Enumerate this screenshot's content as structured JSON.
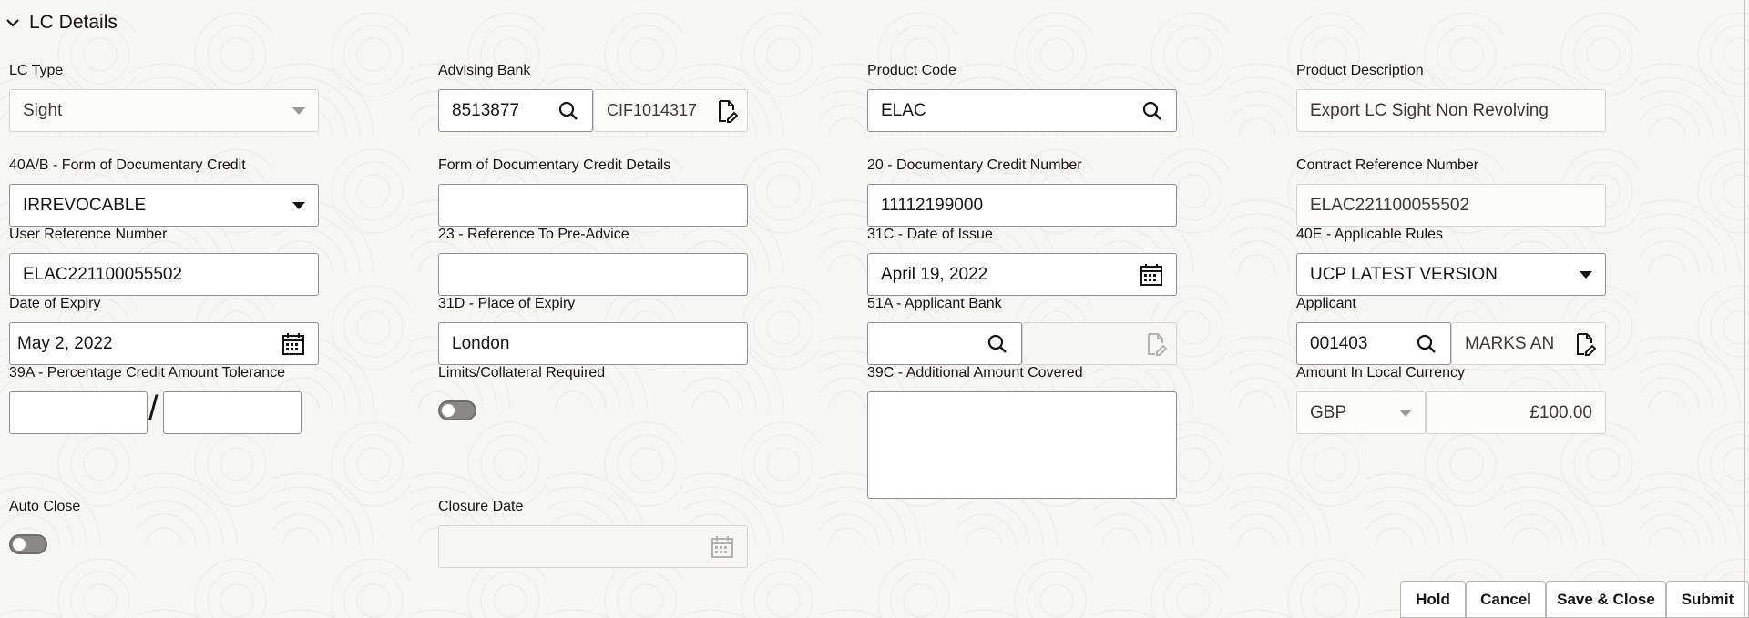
{
  "section": {
    "title": "LC Details"
  },
  "fields": {
    "lc_type": {
      "label": "LC Type",
      "value": "Sight"
    },
    "advising_bank": {
      "label": "Advising Bank",
      "value": "8513877",
      "name_value": "CIF1014317"
    },
    "product_code": {
      "label": "Product Code",
      "value": "ELAC"
    },
    "product_description": {
      "label": "Product Description",
      "value": "Export LC Sight Non Revolving"
    },
    "form_of_credit": {
      "label": "40A/B - Form of Documentary Credit",
      "value": "IRREVOCABLE"
    },
    "form_of_credit_details": {
      "label": "Form of Documentary Credit Details",
      "value": ""
    },
    "doc_credit_number": {
      "label": "20 - Documentary Credit Number",
      "value": "11112199000"
    },
    "contract_reference": {
      "label": "Contract Reference Number",
      "value": "ELAC221100055502"
    },
    "user_reference": {
      "label": "User Reference Number",
      "value": "ELAC221100055502"
    },
    "pre_advice_ref": {
      "label": "23 - Reference To Pre-Advice",
      "value": ""
    },
    "date_of_issue": {
      "label": "31C - Date of Issue",
      "value": "April 19, 2022"
    },
    "applicable_rules": {
      "label": "40E - Applicable Rules",
      "value": "UCP LATEST VERSION"
    },
    "date_of_expiry": {
      "label": "Date of Expiry",
      "value": "May 2, 2022"
    },
    "place_of_expiry": {
      "label": "31D - Place of Expiry",
      "value": "London"
    },
    "applicant_bank": {
      "label": "51A - Applicant Bank",
      "value": "",
      "name_value": ""
    },
    "applicant": {
      "label": "Applicant",
      "value": "001403",
      "name_value": "MARKS AN"
    },
    "tolerance": {
      "label": "39A - Percentage Credit Amount Tolerance",
      "plus": "",
      "separator": "/",
      "minus": ""
    },
    "limits_collateral": {
      "label": "Limits/Collateral Required",
      "on": false
    },
    "additional_amount": {
      "label": "39C - Additional Amount Covered",
      "value": ""
    },
    "local_amount": {
      "label": "Amount In Local Currency",
      "currency": "GBP",
      "amount": "£100.00"
    },
    "auto_close": {
      "label": "Auto Close",
      "on": false
    },
    "closure_date": {
      "label": "Closure Date",
      "value": ""
    }
  },
  "buttons": {
    "hold": "Hold",
    "cancel": "Cancel",
    "save_close": "Save & Close",
    "submit": "Submit"
  },
  "icons": {
    "collapse": "chevron-down-icon",
    "search": "search-icon",
    "details": "document-edit-icon",
    "calendar": "calendar-icon",
    "dropdown": "caret-down-icon"
  }
}
